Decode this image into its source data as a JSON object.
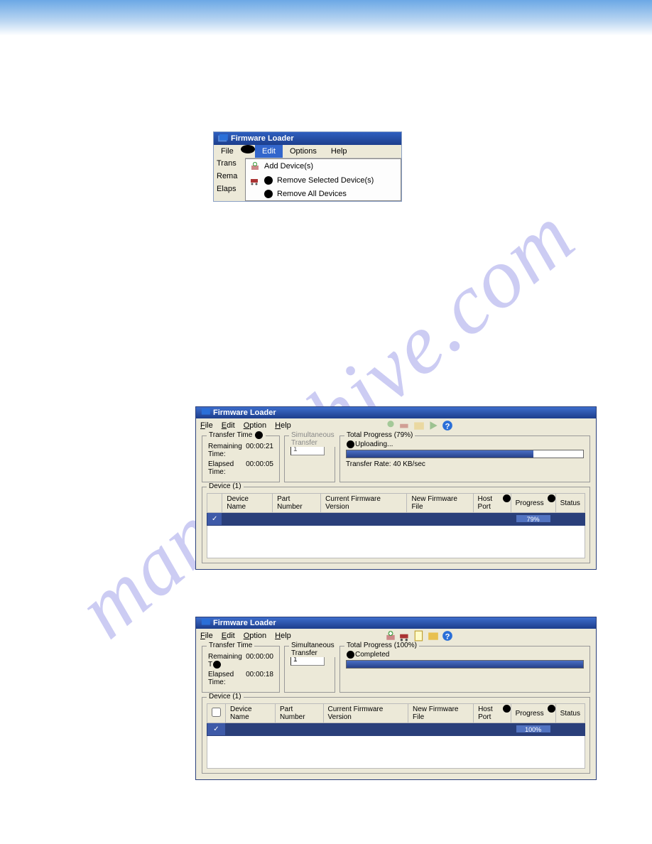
{
  "watermark": "manualshive.com",
  "fig1": {
    "title": "Firmware Loader",
    "menubar": {
      "file": "File",
      "edit": "Edit",
      "options": "Options",
      "help": "Help"
    },
    "items": {
      "add": "Add Device(s)",
      "remove_sel": "Remove Selected Device(s)",
      "remove_all": "Remove All Devices"
    },
    "side": {
      "trans": "Trans",
      "rema": "Rema",
      "elaps": "Elaps"
    }
  },
  "fig2": {
    "title": "Firmware Loader",
    "menubar": {
      "file": "File",
      "edit": "Edit",
      "option": "Option",
      "help": "Help"
    },
    "transfer": {
      "group": "Transfer Time",
      "remaining_label": "Remaining Time:",
      "remaining_val": "00:00:21",
      "elapsed_label": "Elapsed Time:",
      "elapsed_val": "00:00:05"
    },
    "sim": {
      "group": "Simultaneous Transfer",
      "value": "1"
    },
    "total": {
      "group": "Total Progress (79%)",
      "status": "Uploading...",
      "rate": "Transfer Rate: 40 KB/sec",
      "percent": 79
    },
    "device_group": "Device (1)",
    "cols": {
      "chk": "",
      "name": "Device Name",
      "part": "Part Number",
      "fw": "Current Firmware Version",
      "newfw": "New Firmware File",
      "host": "Host Port",
      "prog": "Progress",
      "status": "Status"
    },
    "row": {
      "check": "✓",
      "prog": "79%"
    }
  },
  "fig3": {
    "title": "Firmware Loader",
    "menubar": {
      "file": "File",
      "edit": "Edit",
      "option": "Option",
      "help": "Help"
    },
    "transfer": {
      "group": "Transfer Time",
      "remaining_label": "Remaining T",
      "remaining_val": "00:00:00",
      "elapsed_label": "Elapsed Time:",
      "elapsed_val": "00:00:18"
    },
    "sim": {
      "group": "Simultaneous Transfer",
      "value": "1"
    },
    "total": {
      "group": "Total Progress (100%)",
      "status": "Completed",
      "percent": 100
    },
    "device_group": "Device (1)",
    "cols": {
      "chk": "",
      "name": "Device Name",
      "part": "Part Number",
      "fw": "Current Firmware Version",
      "newfw": "New Firmware File",
      "host": "Host Port",
      "prog": "Progress",
      "status": "Status"
    },
    "row": {
      "check": "✓",
      "prog": "100%"
    }
  }
}
